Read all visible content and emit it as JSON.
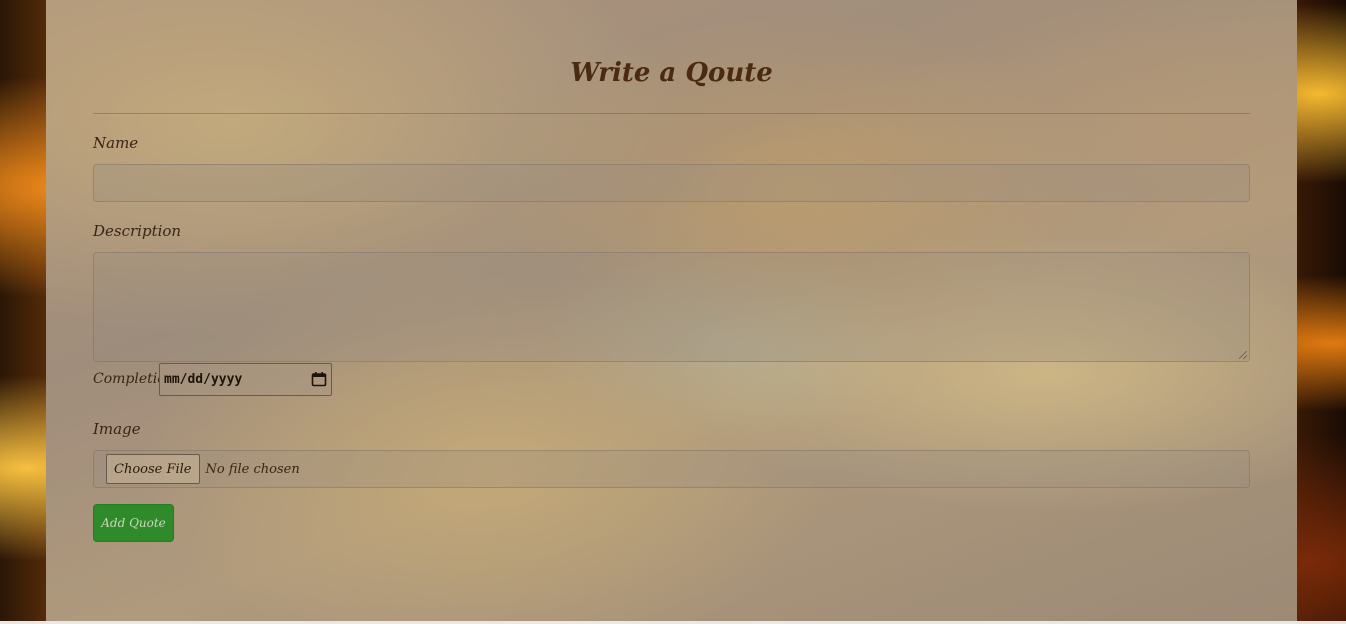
{
  "form": {
    "title": "Write a Qoute",
    "name_label": "Name",
    "name_value": "",
    "description_label": "Description",
    "description_value": "",
    "completion_label": "Completion",
    "completion_placeholder": "mm/dd/yyyy",
    "image_label": "Image",
    "choose_file_label": "Choose File",
    "file_status": "No file chosen",
    "submit_label": "Add Quote"
  },
  "colors": {
    "submit_button": "#2f8a2a",
    "title_text": "#4a2a10"
  },
  "icons": {
    "date_picker": "calendar-icon"
  }
}
